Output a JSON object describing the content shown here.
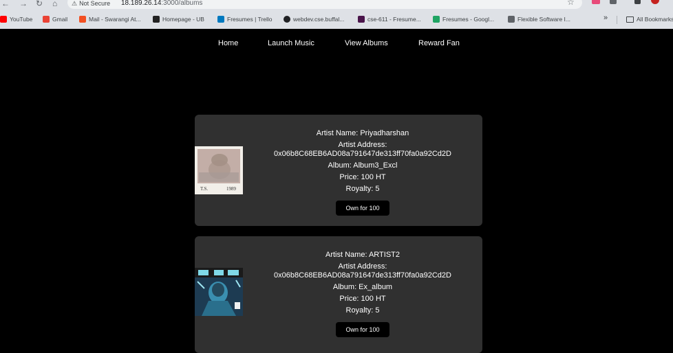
{
  "browser": {
    "security_label": "Not Secure",
    "url_host": "18.189.26.14",
    "url_path": ":3000/albums",
    "bookmarks": [
      {
        "label": "YouTube",
        "icon": "youtube-icon",
        "color": "#ff0000"
      },
      {
        "label": "Gmail",
        "icon": "gmail-icon",
        "color": "#ea4335"
      },
      {
        "label": "Mail - Swarangi At...",
        "icon": "microsoft-icon",
        "color": "#f25022"
      },
      {
        "label": "Homepage - UB",
        "icon": "ub-icon",
        "color": "#222222"
      },
      {
        "label": "Fresumes | Trello",
        "icon": "trello-icon",
        "color": "#0079bf"
      },
      {
        "label": "webdev.cse.buffal...",
        "icon": "globe-icon",
        "color": "#202124"
      },
      {
        "label": "cse-611 - Fresume...",
        "icon": "slack-icon",
        "color": "#4a154b"
      },
      {
        "label": "Fresumes - Googl...",
        "icon": "drive-icon",
        "color": "#1fa463"
      },
      {
        "label": "Flexible Software I...",
        "icon": "doc-icon",
        "color": "#5f6368"
      }
    ],
    "more_label": "»",
    "all_bookmarks_label": "All Bookmarks"
  },
  "nav": {
    "items": [
      "Home",
      "Launch Music",
      "View Albums",
      "Reward Fan"
    ]
  },
  "albums": [
    {
      "artist_name": "Artist Name: Priyadharshan",
      "artist_address_label": "Artist Address:",
      "artist_address": "0x06b8C68EB6AD08a791647de313ff70fa0a92Cd2D",
      "album": "Album: Album3_Excl",
      "price": "Price: 100 HT",
      "royalty": "Royalty: 5",
      "button_label": "Own for 100",
      "cover_text_left": "T.S.",
      "cover_text_right": "1989"
    },
    {
      "artist_name": "Artist Name: ARTIST2",
      "artist_address_label": "Artist Address:",
      "artist_address": "0x06b8C68EB6AD08a791647de313ff70fa0a92Cd2D",
      "album": "Album: Ex_album",
      "price": "Price: 100 HT",
      "royalty": "Royalty: 5",
      "button_label": "Own for 100"
    }
  ],
  "colors": {
    "page_bg": "#000000",
    "card_bg": "#303030",
    "button_bg": "#000000",
    "chrome_bg": "#dee1e6"
  }
}
